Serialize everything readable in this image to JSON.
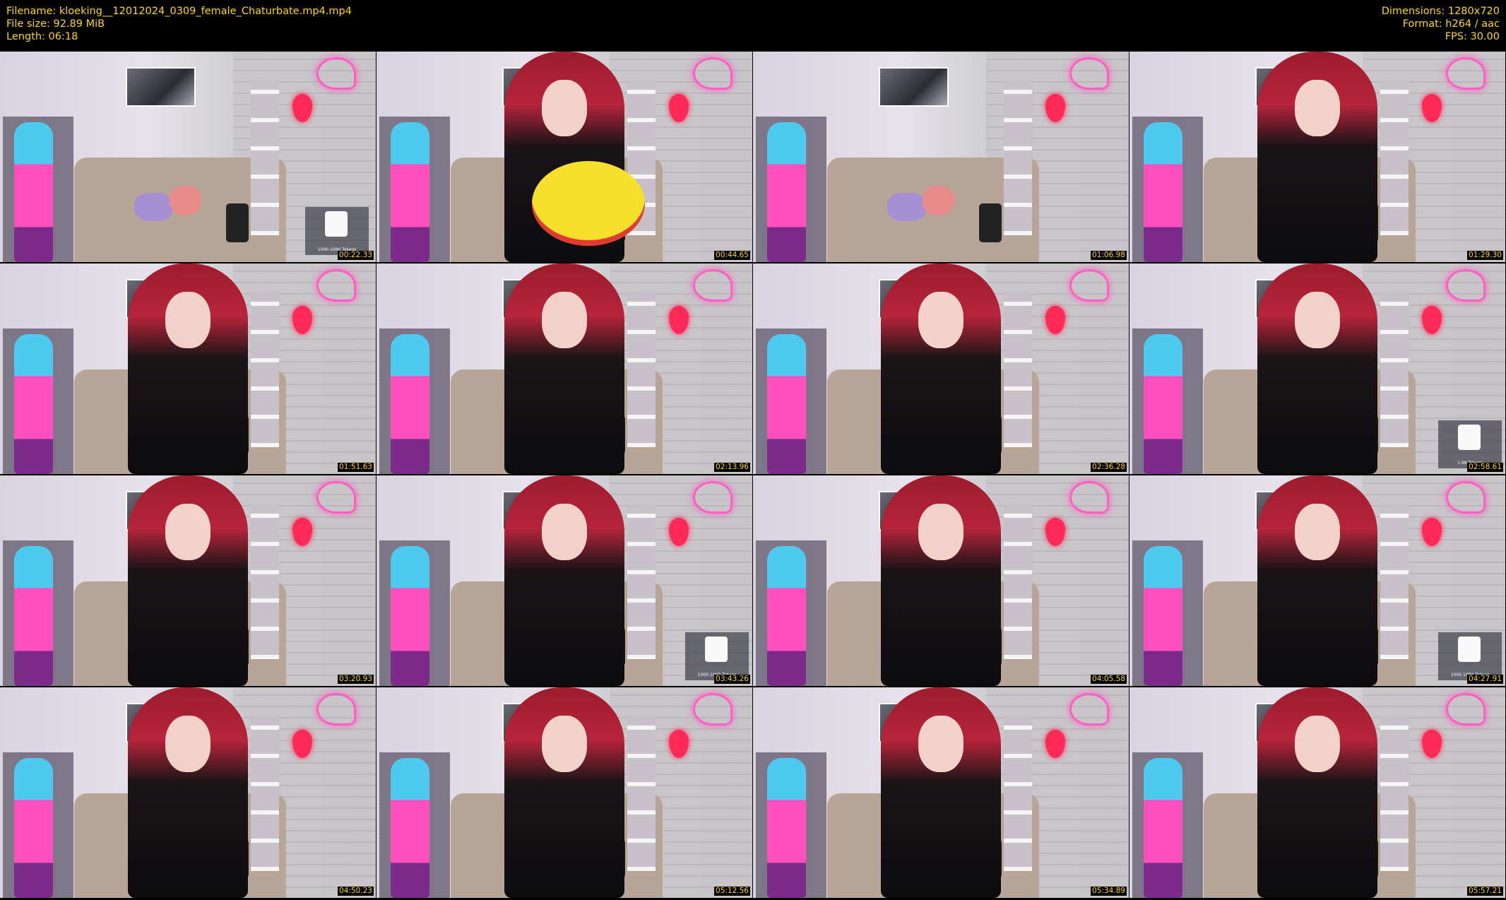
{
  "header": {
    "filename": "Filename: kloeking__12012024_0309_female_Chaturbate.mp4.mp4",
    "filesize": "File size: 92.89 MiB",
    "length": "Length: 06:18",
    "dimensions": "Dimensions: 1280x720",
    "format": "Format: h264 / aac",
    "fps": "FPS: 30.00"
  },
  "thumbnails": [
    {
      "timestamp": "00:22.33",
      "scene": "empty",
      "tip": "1000-1090\nTokens"
    },
    {
      "timestamp": "00:44.65",
      "scene": "hat"
    },
    {
      "timestamp": "01:06.98",
      "scene": "empty"
    },
    {
      "timestamp": "01:29.30",
      "scene": "person"
    },
    {
      "timestamp": "01:51.63",
      "scene": "person"
    },
    {
      "timestamp": "02:13.96",
      "scene": "person"
    },
    {
      "timestamp": "02:36.28",
      "scene": "person"
    },
    {
      "timestamp": "02:58.61",
      "scene": "person",
      "tip": "1-99 Tokens"
    },
    {
      "timestamp": "03:20.93",
      "scene": "person"
    },
    {
      "timestamp": "03:43.26",
      "scene": "person",
      "tip": "1000-1090\nTokens"
    },
    {
      "timestamp": "04:05.58",
      "scene": "person"
    },
    {
      "timestamp": "04:27.91",
      "scene": "person",
      "tip": "1000-1090\nTokens"
    },
    {
      "timestamp": "04:50.23",
      "scene": "person"
    },
    {
      "timestamp": "05:12.56",
      "scene": "person"
    },
    {
      "timestamp": "05:34.89",
      "scene": "person"
    },
    {
      "timestamp": "05:57.21",
      "scene": "person"
    }
  ]
}
